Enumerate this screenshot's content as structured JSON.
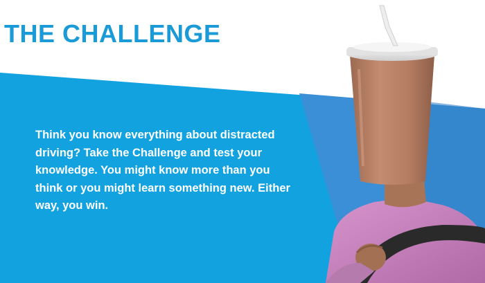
{
  "page": {
    "title": "THE CHALLENGE",
    "body": "Think you know everything about distracted driving? Take the Challenge and test your knowledge. You might know more than you think or you might learn something new. Either way, you win."
  },
  "colors": {
    "brand_blue": "#1a9ad7",
    "banner_blue": "#12a2e0",
    "banner_stripe": "#3b8fd6",
    "text_on_banner": "#ffffff",
    "cup_brown": "#b87f64",
    "shirt_pink": "#c47fbb"
  },
  "illustration": {
    "subject": "person-with-drink-cup-on-head-holding-steering-wheel"
  }
}
